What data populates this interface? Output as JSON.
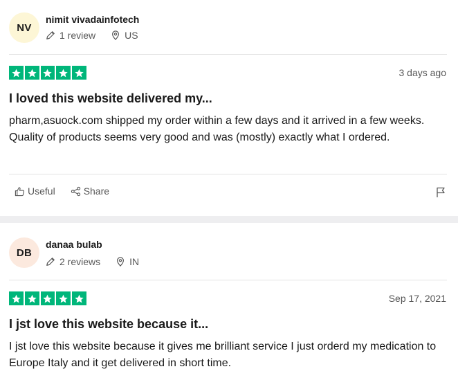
{
  "reviews": [
    {
      "avatar_initials": "NV",
      "name": "nimit vivadainfotech",
      "review_count": "1 review",
      "country": "US",
      "rating": 5,
      "date": "3 days ago",
      "title": "I loved this website delivered my...",
      "body": "pharm,asuock.com shipped my order within a few days and it arrived in a few weeks. Quality of products seems very good and was (mostly) exactly what I ordered.",
      "useful_label": "Useful",
      "share_label": "Share"
    },
    {
      "avatar_initials": "DB",
      "name": "danaa bulab",
      "review_count": "2 reviews",
      "country": "IN",
      "rating": 5,
      "date": "Sep 17, 2021",
      "title": "I jst love this website because it...",
      "body": "I jst love this website because it gives me brilliant service I just orderd my medication to Europe Italy and it get delivered in short time."
    }
  ],
  "colors": {
    "star_green": "#00b67a",
    "avatar_nv": "#fdf6d6",
    "avatar_db": "#fce9de",
    "muted_text": "#575757"
  },
  "icons": {
    "edit": "pencil-icon",
    "location": "location-pin-icon",
    "useful": "thumbs-up-icon",
    "share": "share-icon",
    "report": "flag-icon",
    "star": "star-icon"
  }
}
